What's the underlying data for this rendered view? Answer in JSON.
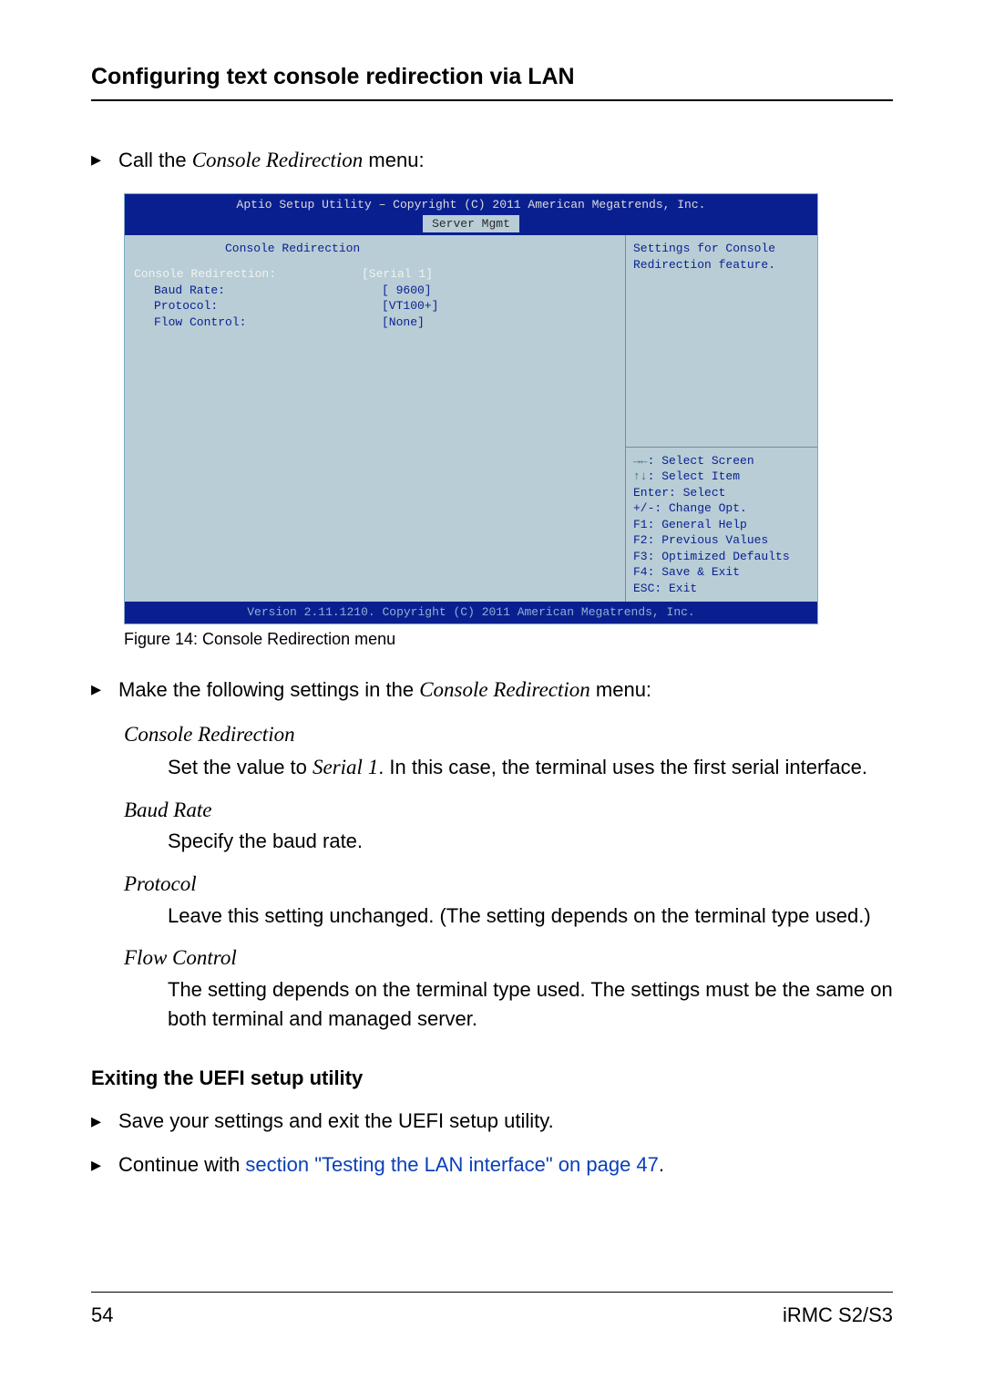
{
  "header": {
    "title": "Configuring text console redirection via LAN"
  },
  "intro": {
    "bullet_glyph": "▸",
    "prefix": "Call the ",
    "menu_name": "Console Redirection",
    "suffix": " menu:"
  },
  "bios": {
    "header_line": "Aptio Setup Utility – Copyright (C) 2011 American Megatrends, Inc.",
    "tab": "Server Mgmt",
    "section_title": "Console Redirection",
    "rows": [
      {
        "label": "Console Redirection:",
        "value": "[Serial 1]",
        "indent": false
      },
      {
        "label": "Baud Rate:",
        "value": "[ 9600]",
        "indent": true
      },
      {
        "label": "Protocol:",
        "value": "[VT100+]",
        "indent": true
      },
      {
        "label": "Flow Control:",
        "value": "[None]",
        "indent": true
      }
    ],
    "help_top": "Settings for Console Redirection feature.",
    "help_keys": [
      {
        "key": "→←",
        "text": ": Select Screen"
      },
      {
        "key": "↑↓",
        "text": ": Select Item"
      },
      {
        "key": "Enter",
        "text": ": Select"
      },
      {
        "key": "+/-",
        "text": ": Change Opt."
      },
      {
        "key": "F1",
        "text": ": General Help"
      },
      {
        "key": "F2",
        "text": ": Previous Values"
      },
      {
        "key": "F3",
        "text": ": Optimized Defaults"
      },
      {
        "key": "F4",
        "text": ": Save & Exit"
      },
      {
        "key": "ESC",
        "text": ": Exit"
      }
    ],
    "footer": "Version 2.11.1210. Copyright (C) 2011 American Megatrends, Inc."
  },
  "figure_caption": "Figure 14: Console Redirection menu",
  "settings_bullet": {
    "glyph": "▸",
    "prefix": "Make the following settings in the ",
    "menu_name": "Console Redirection",
    "suffix": " menu:"
  },
  "defs": {
    "d1": {
      "term": "Console Redirection",
      "body_pre": "Set the value to ",
      "body_em": "Serial 1",
      "body_post": ". In this case, the terminal uses the first serial interface."
    },
    "d2": {
      "term": "Baud Rate",
      "body": "Specify the baud rate."
    },
    "d3": {
      "term": "Protocol",
      "body": "Leave this setting unchanged. (The setting depends on the terminal type used.)"
    },
    "d4": {
      "term": "Flow Control",
      "body": "The setting depends on the terminal type used. The settings must be the same on both terminal and managed server."
    }
  },
  "subheading": "Exiting the UEFI setup utility",
  "exit_bullets": {
    "glyph": "▸",
    "b1": "Save your settings and exit the UEFI setup utility.",
    "b2_pre": "Continue with ",
    "b2_link": "section \"Testing the LAN interface\" on page 47",
    "b2_post": "."
  },
  "footer": {
    "page": "54",
    "doc": "iRMC S2/S3"
  }
}
